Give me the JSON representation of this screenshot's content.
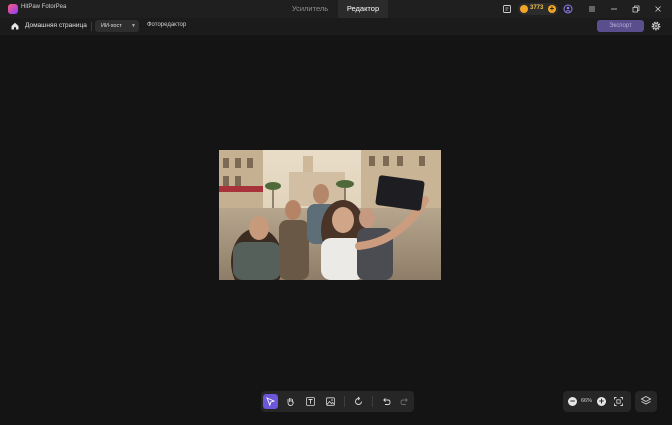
{
  "app": {
    "name": "HitPaw FotorPea"
  },
  "tabs": [
    {
      "label": "Усилитель"
    },
    {
      "label": "Редактор"
    }
  ],
  "titlebar": {
    "credits": "3773"
  },
  "toolbar": {
    "home_label": "Домашняя страница",
    "mode_select": "ИИ-хост",
    "breadcrumb": "Фоторедактор",
    "export_label": "Экспорт"
  },
  "zoom": {
    "value": "66%"
  },
  "colors": {
    "accent": "#6a58d8",
    "background": "#141414",
    "coin": "#f0a727",
    "export_button": "#5a4f8c"
  },
  "icons": [
    "app-logo-icon",
    "feedback-icon",
    "coin-icon",
    "user-icon",
    "menu-icon",
    "minimize-icon",
    "restore-icon",
    "close-icon",
    "home-icon",
    "chevron-down-icon",
    "settings-icon",
    "select-tool-icon",
    "hand-tool-icon",
    "text-tool-icon",
    "image-tool-icon",
    "rotate-icon",
    "undo-icon",
    "redo-icon",
    "zoom-out-icon",
    "zoom-in-icon",
    "fit-screen-icon",
    "layers-icon"
  ]
}
